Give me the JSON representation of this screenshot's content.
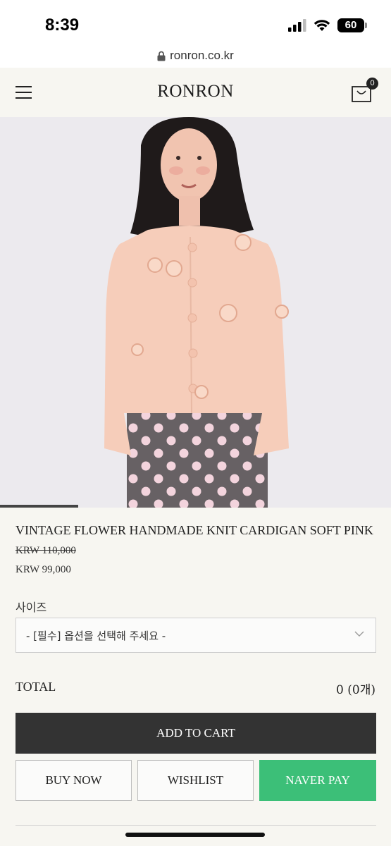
{
  "status": {
    "time": "8:39",
    "battery": "60"
  },
  "browser": {
    "url": "ronron.co.kr"
  },
  "header": {
    "logo": "RONRON",
    "cart_count": "0"
  },
  "product": {
    "name": "VINTAGE FLOWER HANDMADE KNIT CARDIGAN SOFT PINK",
    "price_original": "KRW 110,000",
    "price_sale": "KRW 99,000",
    "image_gallery_position": 0.2
  },
  "options": {
    "size_label": "사이즈",
    "size_select_value": "- [필수] 옵션을 선택해 주세요 -"
  },
  "total": {
    "label": "TOTAL",
    "value": "0 (0개)"
  },
  "actions": {
    "add_to_cart": "ADD TO CART",
    "buy_now": "BUY NOW",
    "wishlist": "WISHLIST",
    "naver_pay": "NAVER PAY"
  },
  "colors": {
    "naver_green": "#3cbf78",
    "button_dark": "#333333",
    "background": "#f7f6f1"
  }
}
